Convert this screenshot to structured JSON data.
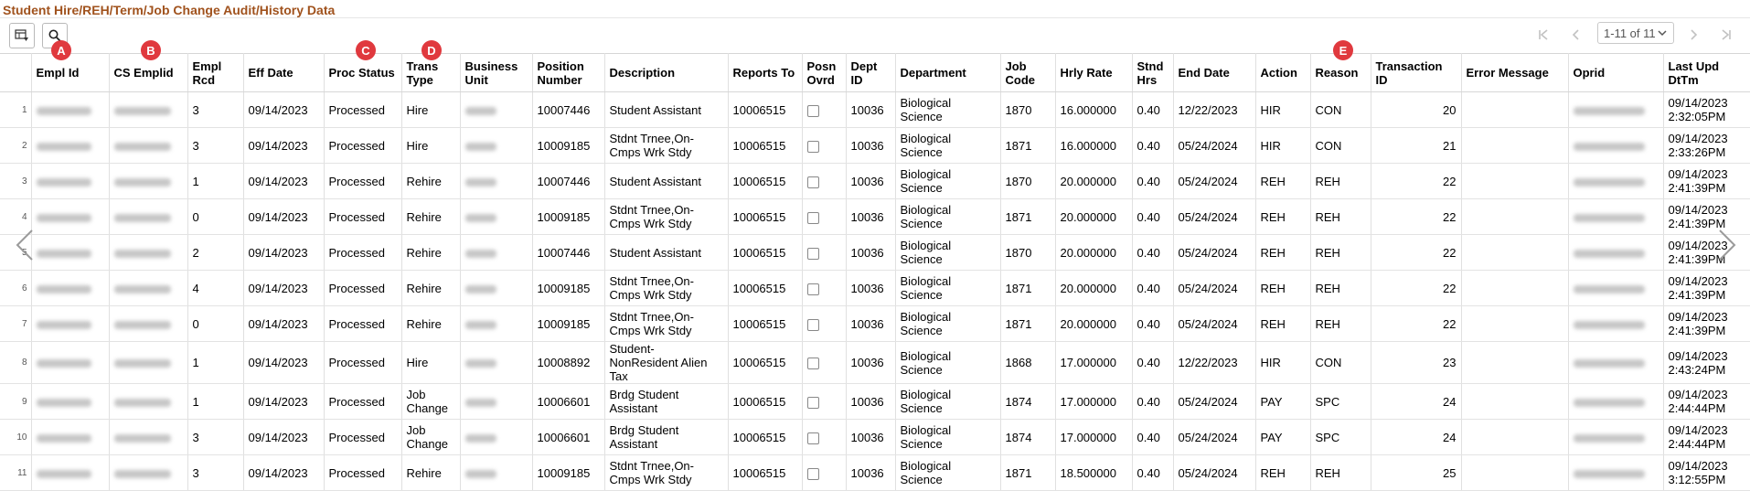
{
  "page": {
    "title": "Student Hire/REH/Term/Job Change Audit/History Data"
  },
  "pagination": {
    "page_label": "1-11 of 11"
  },
  "badges": [
    "A",
    "B",
    "C",
    "D",
    "E"
  ],
  "columns": {
    "empl_id": "Empl Id",
    "cs_emplid": "CS Emplid",
    "empl_rcd": "Empl Rcd",
    "eff_date": "Eff Date",
    "proc_status": "Proc Status",
    "trans_type": "Trans Type",
    "business_unit": "Business Unit",
    "position_number": "Position Number",
    "description": "Description",
    "reports_to": "Reports To",
    "posn_ovrd": "Posn Ovrd",
    "dept_id": "Dept ID",
    "department": "Department",
    "job_code": "Job Code",
    "hrly_rate": "Hrly Rate",
    "stnd_hrs": "Stnd Hrs",
    "end_date": "End Date",
    "action": "Action",
    "reason": "Reason",
    "transaction_id": "Transaction ID",
    "error_message": "Error Message",
    "oprid": "Oprid",
    "last_upd": "Last Upd DtTm"
  },
  "rows": [
    {
      "n": "1",
      "rcd": "3",
      "eff": "09/14/2023",
      "status": "Processed",
      "trans": "Hire",
      "pos": "10007446",
      "desc": "Student Assistant",
      "rep": "10006515",
      "dept": "10036",
      "deptname": "Biological Science",
      "job": "1870",
      "rate": "16.000000",
      "hrs": "0.40",
      "end": "12/22/2023",
      "action": "HIR",
      "reason": "CON",
      "tid": "20",
      "upd": "09/14/2023 2:32:05PM"
    },
    {
      "n": "2",
      "rcd": "3",
      "eff": "09/14/2023",
      "status": "Processed",
      "trans": "Hire",
      "pos": "10009185",
      "desc": "Stdnt Trnee,On-Cmps Wrk Stdy",
      "rep": "10006515",
      "dept": "10036",
      "deptname": "Biological Science",
      "job": "1871",
      "rate": "16.000000",
      "hrs": "0.40",
      "end": "05/24/2024",
      "action": "HIR",
      "reason": "CON",
      "tid": "21",
      "upd": "09/14/2023 2:33:26PM"
    },
    {
      "n": "3",
      "rcd": "1",
      "eff": "09/14/2023",
      "status": "Processed",
      "trans": "Rehire",
      "pos": "10007446",
      "desc": "Student Assistant",
      "rep": "10006515",
      "dept": "10036",
      "deptname": "Biological Science",
      "job": "1870",
      "rate": "20.000000",
      "hrs": "0.40",
      "end": "05/24/2024",
      "action": "REH",
      "reason": "REH",
      "tid": "22",
      "upd": "09/14/2023 2:41:39PM"
    },
    {
      "n": "4",
      "rcd": "0",
      "eff": "09/14/2023",
      "status": "Processed",
      "trans": "Rehire",
      "pos": "10009185",
      "desc": "Stdnt Trnee,On-Cmps Wrk Stdy",
      "rep": "10006515",
      "dept": "10036",
      "deptname": "Biological Science",
      "job": "1871",
      "rate": "20.000000",
      "hrs": "0.40",
      "end": "05/24/2024",
      "action": "REH",
      "reason": "REH",
      "tid": "22",
      "upd": "09/14/2023 2:41:39PM"
    },
    {
      "n": "5",
      "rcd": "2",
      "eff": "09/14/2023",
      "status": "Processed",
      "trans": "Rehire",
      "pos": "10007446",
      "desc": "Student Assistant",
      "rep": "10006515",
      "dept": "10036",
      "deptname": "Biological Science",
      "job": "1870",
      "rate": "20.000000",
      "hrs": "0.40",
      "end": "05/24/2024",
      "action": "REH",
      "reason": "REH",
      "tid": "22",
      "upd": "09/14/2023 2:41:39PM"
    },
    {
      "n": "6",
      "rcd": "4",
      "eff": "09/14/2023",
      "status": "Processed",
      "trans": "Rehire",
      "pos": "10009185",
      "desc": "Stdnt Trnee,On-Cmps Wrk Stdy",
      "rep": "10006515",
      "dept": "10036",
      "deptname": "Biological Science",
      "job": "1871",
      "rate": "20.000000",
      "hrs": "0.40",
      "end": "05/24/2024",
      "action": "REH",
      "reason": "REH",
      "tid": "22",
      "upd": "09/14/2023 2:41:39PM"
    },
    {
      "n": "7",
      "rcd": "0",
      "eff": "09/14/2023",
      "status": "Processed",
      "trans": "Rehire",
      "pos": "10009185",
      "desc": "Stdnt Trnee,On-Cmps Wrk Stdy",
      "rep": "10006515",
      "dept": "10036",
      "deptname": "Biological Science",
      "job": "1871",
      "rate": "20.000000",
      "hrs": "0.40",
      "end": "05/24/2024",
      "action": "REH",
      "reason": "REH",
      "tid": "22",
      "upd": "09/14/2023 2:41:39PM"
    },
    {
      "n": "8",
      "rcd": "1",
      "eff": "09/14/2023",
      "status": "Processed",
      "trans": "Hire",
      "pos": "10008892",
      "desc": "Student-NonResident Alien Tax",
      "rep": "10006515",
      "dept": "10036",
      "deptname": "Biological Science",
      "job": "1868",
      "rate": "17.000000",
      "hrs": "0.40",
      "end": "12/22/2023",
      "action": "HIR",
      "reason": "CON",
      "tid": "23",
      "upd": "09/14/2023 2:43:24PM"
    },
    {
      "n": "9",
      "rcd": "1",
      "eff": "09/14/2023",
      "status": "Processed",
      "trans": "Job Change",
      "pos": "10006601",
      "desc": "Brdg Student Assistant",
      "rep": "10006515",
      "dept": "10036",
      "deptname": "Biological Science",
      "job": "1874",
      "rate": "17.000000",
      "hrs": "0.40",
      "end": "05/24/2024",
      "action": "PAY",
      "reason": "SPC",
      "tid": "24",
      "upd": "09/14/2023 2:44:44PM"
    },
    {
      "n": "10",
      "rcd": "3",
      "eff": "09/14/2023",
      "status": "Processed",
      "trans": "Job Change",
      "pos": "10006601",
      "desc": "Brdg Student Assistant",
      "rep": "10006515",
      "dept": "10036",
      "deptname": "Biological Science",
      "job": "1874",
      "rate": "17.000000",
      "hrs": "0.40",
      "end": "05/24/2024",
      "action": "PAY",
      "reason": "SPC",
      "tid": "24",
      "upd": "09/14/2023 2:44:44PM"
    },
    {
      "n": "11",
      "rcd": "3",
      "eff": "09/14/2023",
      "status": "Processed",
      "trans": "Rehire",
      "pos": "10009185",
      "desc": "Stdnt Trnee,On-Cmps Wrk Stdy",
      "rep": "10006515",
      "dept": "10036",
      "deptname": "Biological Science",
      "job": "1871",
      "rate": "18.500000",
      "hrs": "0.40",
      "end": "05/24/2024",
      "action": "REH",
      "reason": "REH",
      "tid": "25",
      "upd": "09/14/2023 3:12:55PM"
    }
  ]
}
